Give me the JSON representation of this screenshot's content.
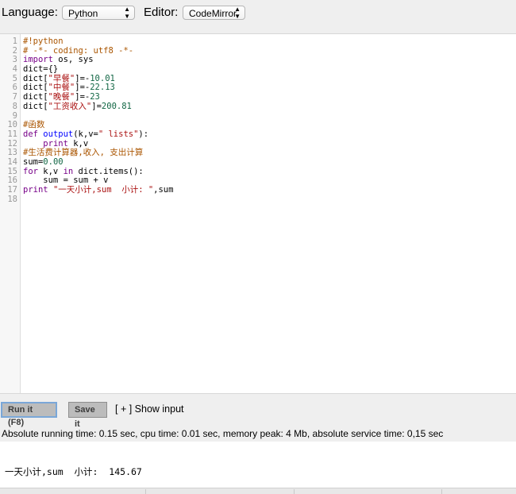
{
  "toolbar": {
    "language_label": "Language:",
    "language_value": "Python",
    "editor_label": "Editor:",
    "editor_value": "CodeMirror"
  },
  "code_lines": [
    {
      "n": "1",
      "parts": [
        [
          "cm",
          "#!python"
        ]
      ]
    },
    {
      "n": "2",
      "parts": [
        [
          "cm",
          "# -*- coding: utf8 -*-"
        ]
      ]
    },
    {
      "n": "3",
      "parts": [
        [
          "kw",
          "import"
        ],
        [
          "vr",
          " os, sys"
        ]
      ]
    },
    {
      "n": "4",
      "parts": [
        [
          "vr",
          "dict={}"
        ]
      ]
    },
    {
      "n": "5",
      "parts": [
        [
          "vr",
          "dict["
        ],
        [
          "st",
          "\"早餐\""
        ],
        [
          "vr",
          "]=-"
        ],
        [
          "nu",
          "10.01"
        ]
      ]
    },
    {
      "n": "6",
      "parts": [
        [
          "vr",
          "dict["
        ],
        [
          "st",
          "\"中餐\""
        ],
        [
          "vr",
          "]=-"
        ],
        [
          "nu",
          "22.13"
        ]
      ]
    },
    {
      "n": "7",
      "parts": [
        [
          "vr",
          "dict["
        ],
        [
          "st",
          "\"晚餐\""
        ],
        [
          "vr",
          "]=-"
        ],
        [
          "nu",
          "23"
        ]
      ]
    },
    {
      "n": "8",
      "parts": [
        [
          "vr",
          "dict["
        ],
        [
          "st",
          "\"工资收入\""
        ],
        [
          "vr",
          "]="
        ],
        [
          "nu",
          "200.81"
        ]
      ]
    },
    {
      "n": "9",
      "parts": []
    },
    {
      "n": "10",
      "parts": [
        [
          "cm",
          "#函数"
        ]
      ]
    },
    {
      "n": "11",
      "parts": [
        [
          "kw",
          "def"
        ],
        [
          "vr",
          " "
        ],
        [
          "df",
          "output"
        ],
        [
          "vr",
          "(k,v="
        ],
        [
          "st",
          "\" lists\""
        ],
        [
          "vr",
          "):"
        ]
      ]
    },
    {
      "n": "12",
      "parts": [
        [
          "vr",
          "    "
        ],
        [
          "kw",
          "print"
        ],
        [
          "vr",
          " k,v"
        ]
      ]
    },
    {
      "n": "13",
      "parts": [
        [
          "cm",
          "#生活费计算器,收入, 支出计算"
        ]
      ]
    },
    {
      "n": "14",
      "parts": [
        [
          "vr",
          "sum="
        ],
        [
          "nu",
          "0.00"
        ]
      ]
    },
    {
      "n": "15",
      "parts": [
        [
          "kw",
          "for"
        ],
        [
          "vr",
          " k,v "
        ],
        [
          "kw",
          "in"
        ],
        [
          "vr",
          " dict.items():"
        ]
      ]
    },
    {
      "n": "16",
      "parts": [
        [
          "vr",
          "    sum = sum + v"
        ]
      ]
    },
    {
      "n": "17",
      "parts": [
        [
          "kw",
          "print"
        ],
        [
          "vr",
          " "
        ],
        [
          "st",
          "\"一天小计,sum  小计: \""
        ],
        [
          "vr",
          ",sum"
        ]
      ]
    },
    {
      "n": "18",
      "parts": []
    }
  ],
  "actions": {
    "run_label": "Run it (F8)",
    "save_label": "Save it",
    "show_input_label": "[ + ] Show input"
  },
  "stats_text": "Absolute running time: 0.15 sec, cpu time: 0.01 sec, memory peak: 4 Mb, absolute service time: 0,15 sec",
  "output_text": "一天小计,sum  小计:  145.67"
}
